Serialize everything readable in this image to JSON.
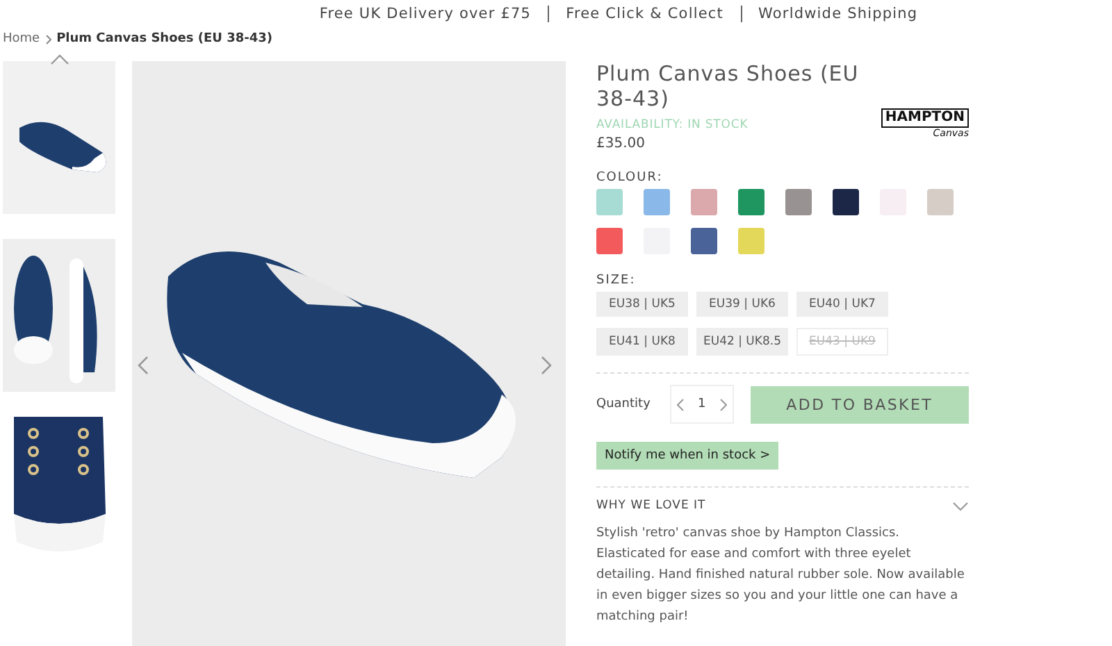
{
  "promo_bar": [
    "Free UK Delivery over £75",
    "Free Click & Collect",
    "Worldwide Shipping"
  ],
  "breadcrumb": [
    {
      "label": "Home",
      "current": false
    },
    {
      "label": "Plum Canvas Shoes (EU 38-43)",
      "current": true
    }
  ],
  "product": {
    "title": "Plum Canvas Shoes (EU 38-43)",
    "brand_logo": {
      "name": "HAMPTON",
      "sub": "Canvas"
    },
    "availability": "AVAILABILITY: IN STOCK",
    "price": "£35.00",
    "colour_label": "COLOUR:",
    "colours": [
      {
        "color": "#a6dcd4"
      },
      {
        "color": "#8ab8e8"
      },
      {
        "color": "#dba8ab"
      },
      {
        "color": "#1f9560"
      },
      {
        "color": "#999292"
      },
      {
        "color": "#1c2748"
      },
      {
        "color": "#f6eef2"
      },
      {
        "color": "#d6cdc6"
      },
      {
        "color": "#f25a5c"
      },
      {
        "color": "#f3f3f5"
      },
      {
        "color": "#4a6399"
      },
      {
        "color": "#e4d85a"
      }
    ],
    "size_label": "SIZE:",
    "sizes": [
      {
        "label": "EU38 | UK5",
        "available": true
      },
      {
        "label": "EU39 | UK6",
        "available": true
      },
      {
        "label": "EU40 | UK7",
        "available": true
      },
      {
        "label": "EU41 | UK8",
        "available": true
      },
      {
        "label": "EU42 | UK8.5",
        "available": true
      },
      {
        "label": "EU43 | UK9",
        "available": false
      }
    ],
    "quantity_label": "Quantity",
    "quantity": "1",
    "add_button": "ADD TO BASKET",
    "notify_button": "Notify me when in stock >",
    "accordion": {
      "title": "WHY WE LOVE IT",
      "expanded": true,
      "text": "Stylish 'retro' canvas shoe by Hampton Classics. Elasticated for ease and comfort with three eyelet detailing. Hand finished natural rubber sole. Now available in even bigger sizes so you and your little one can have a matching pair!"
    }
  }
}
